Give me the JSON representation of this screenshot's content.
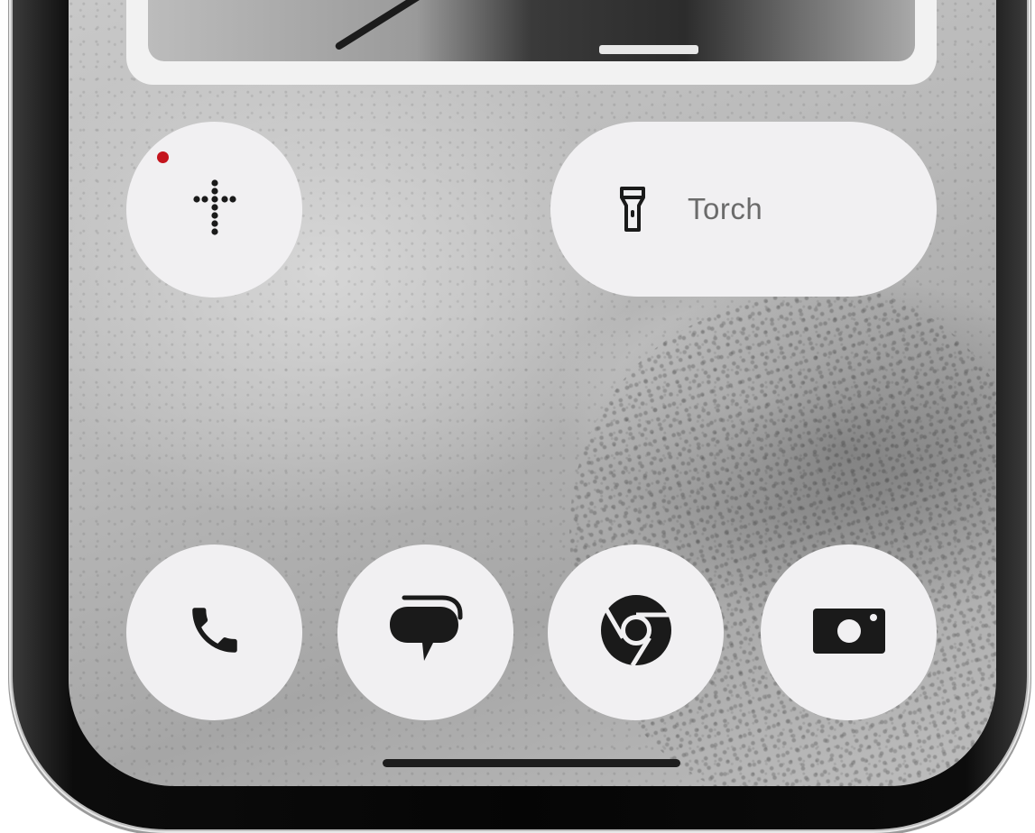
{
  "widgets": {
    "torch": {
      "label": "Torch",
      "icon": "flashlight-icon"
    },
    "rosary": {
      "icon": "rosary-cross-icon",
      "badge_color": "#c4141d"
    }
  },
  "dock": [
    {
      "icon": "phone-icon"
    },
    {
      "icon": "messages-icon"
    },
    {
      "icon": "chrome-icon"
    },
    {
      "icon": "camera-icon"
    }
  ],
  "colors": {
    "button_bg": "#f1f0f2",
    "icon_fg": "#1a1a1a",
    "notification": "#c4141d"
  }
}
